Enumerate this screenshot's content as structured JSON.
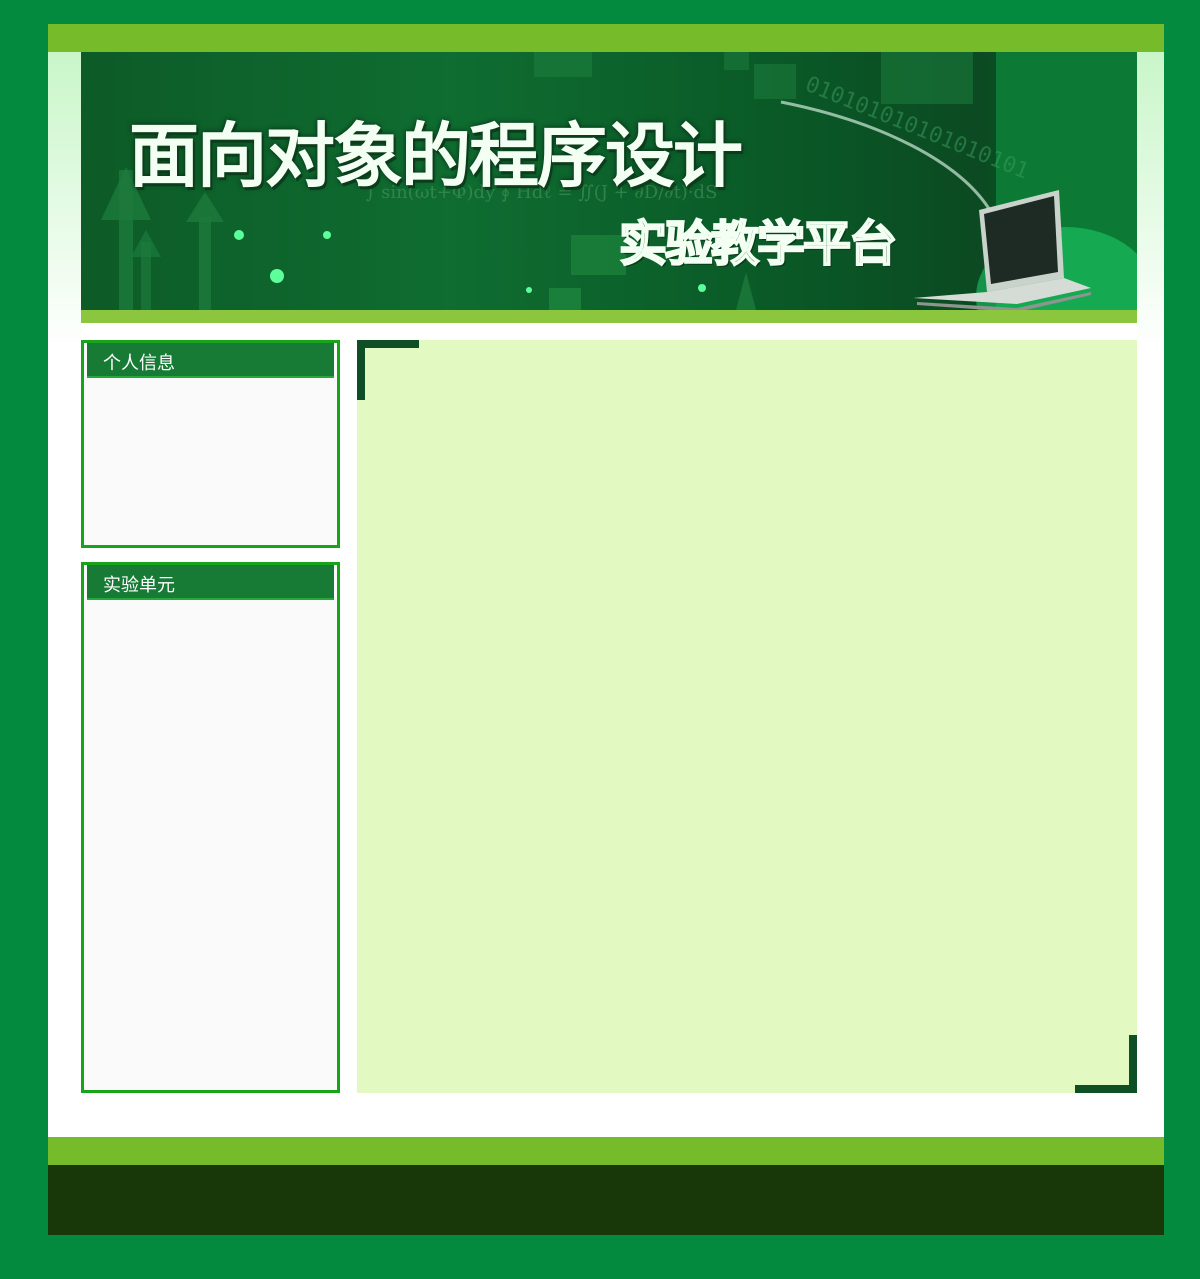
{
  "banner": {
    "title": "面向对象的程序设计",
    "subtitle": "实验教学平台",
    "binary_text": "010101010101010101",
    "formula_text": "∫ sin(ωt+Φ)dy ∮ Hdℓ = ∬(J + ∂D/∂t)·dS",
    "laptop_icon": "laptop-icon"
  },
  "sidebar": {
    "personal_info": {
      "heading": "个人信息"
    },
    "lab_units": {
      "heading": "实验单元"
    }
  },
  "colors": {
    "page_bg": "#038a3f",
    "accent_bar": "#76bb2a",
    "panel_border": "#18a419",
    "panel_header": "#177a35",
    "content_bg": "#e2f9c2",
    "corner_marks": "#0f4f25",
    "footer": "#18380a"
  }
}
